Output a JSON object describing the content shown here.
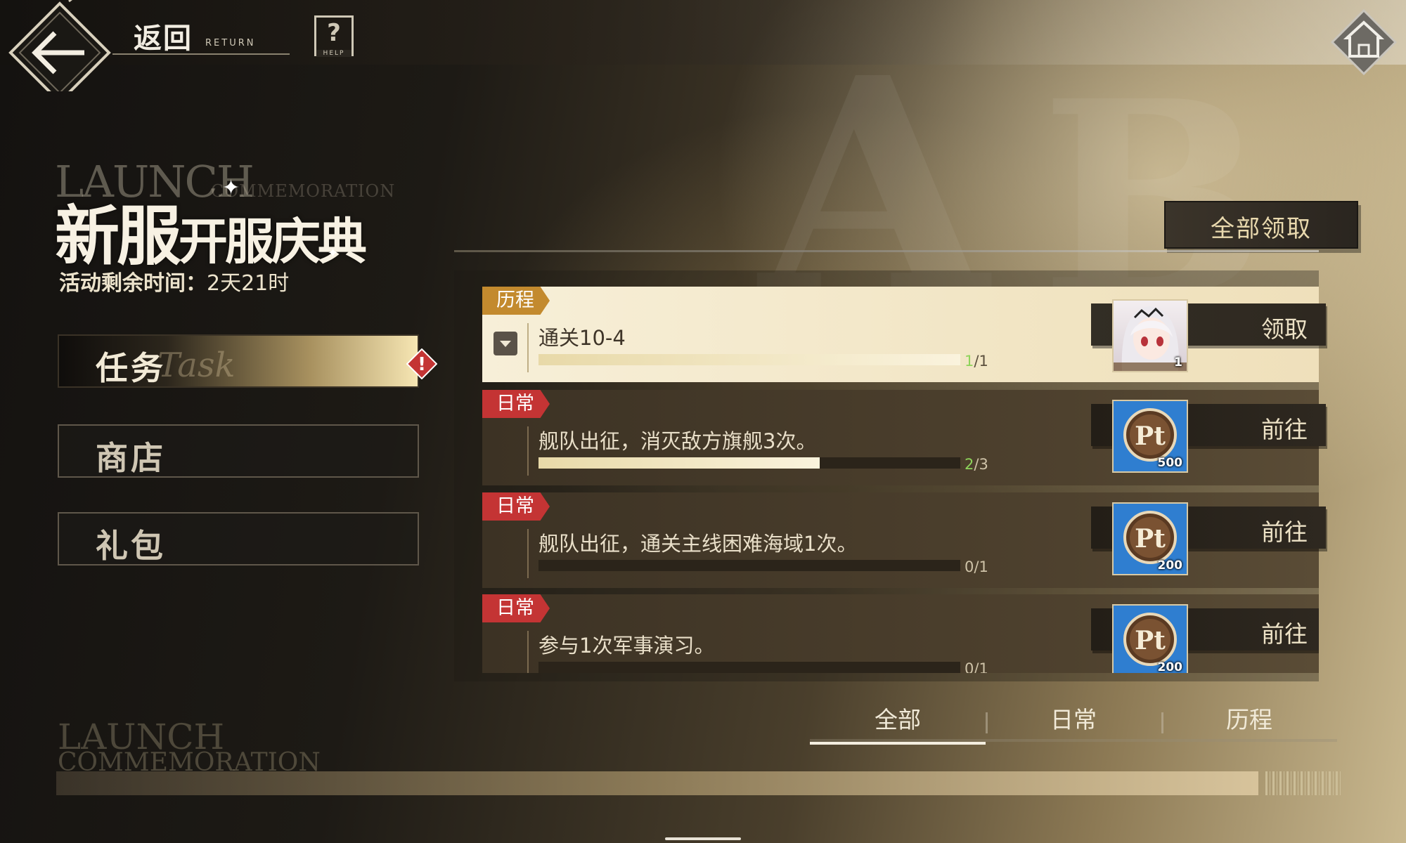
{
  "header": {
    "back_label": "返回",
    "back_label_en": "RETURN",
    "help_symbol": "?",
    "help_label": "HELP"
  },
  "event": {
    "title_en": "LAUNCH",
    "title_en_sub": "COMMEMORATION",
    "title_main": "新服",
    "title_sub": "开服庆典",
    "remaining_label": "活动剩余时间：",
    "remaining_value": "2天21时"
  },
  "sidebar": {
    "items": [
      {
        "label": "任务",
        "ghost": "Task",
        "active": true,
        "alert": "!"
      },
      {
        "label": "商店",
        "active": false
      },
      {
        "label": "礼包",
        "active": false
      }
    ]
  },
  "claim_all_label": "全部领取",
  "tasks": [
    {
      "tag": "历程",
      "type": "history",
      "title": "通关10-4",
      "current": "1",
      "total": "/1",
      "progress": 1.0,
      "reward": "avatar",
      "reward_qty": "1",
      "button": "领取",
      "complete": true
    },
    {
      "tag": "日常",
      "type": "daily",
      "title": "舰队出征，消灭敌方旗舰3次。",
      "current": "2",
      "total": "/3",
      "progress": 0.667,
      "reward": "Pt",
      "reward_qty": "500",
      "button": "前往",
      "complete": false
    },
    {
      "tag": "日常",
      "type": "daily",
      "title": "舰队出征，通关主线困难海域1次。",
      "current": "0",
      "total": "/1",
      "progress": 0.0,
      "reward": "Pt",
      "reward_qty": "200",
      "button": "前往",
      "complete": false
    },
    {
      "tag": "日常",
      "type": "daily",
      "title": "参与1次军事演习。",
      "current": "0",
      "total": "/1",
      "progress": 0.0,
      "reward": "Pt",
      "reward_qty": "200",
      "button": "前往",
      "complete": false
    }
  ],
  "tabs": [
    {
      "label": "全部",
      "active": true
    },
    {
      "label": "日常",
      "active": false
    },
    {
      "label": "历程",
      "active": false
    }
  ],
  "footer": {
    "line1": "LAUNCH",
    "line2": "COMMEMORATION"
  },
  "colors": {
    "daily_tag": "#c43434",
    "history_tag": "#c38a2e",
    "progress_current": "#8dd35a",
    "reward_bg": "#2f7ed0"
  }
}
